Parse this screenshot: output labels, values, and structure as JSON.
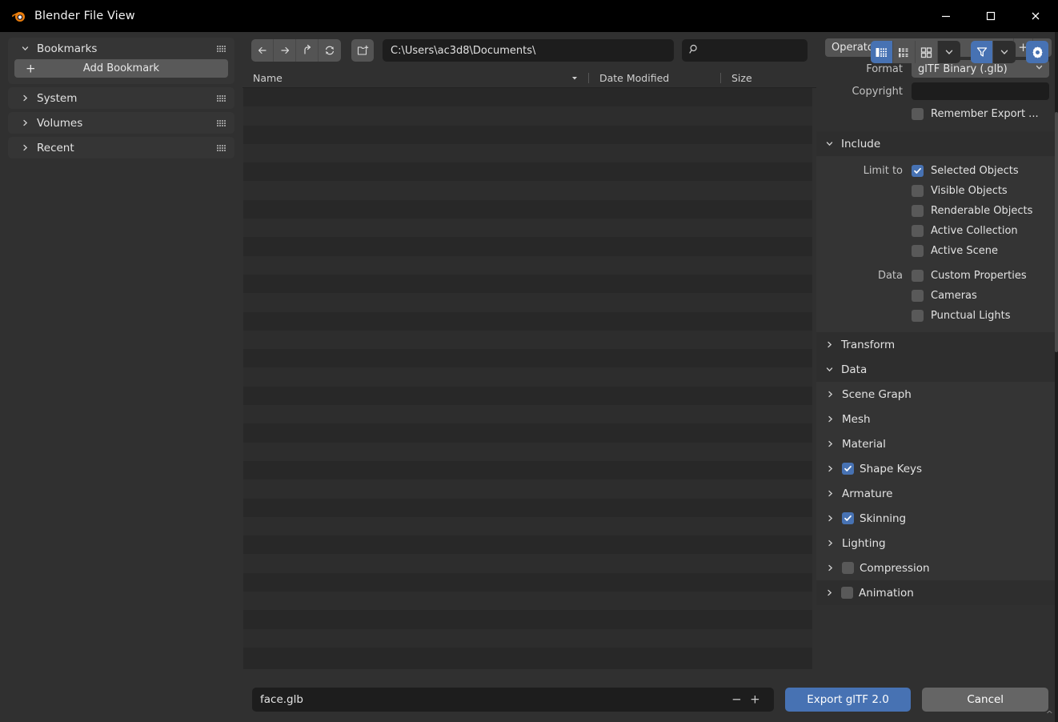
{
  "window": {
    "title": "Blender File View",
    "logo_icon": "blender-logo-icon",
    "minimize_label": "Minimize",
    "maximize_label": "Maximize",
    "close_label": "Close"
  },
  "sidebar": {
    "panels": [
      {
        "title": "Bookmarks",
        "expanded": true,
        "icon": "chevron-down-icon"
      },
      {
        "title": "System",
        "expanded": false,
        "icon": "chevron-right-icon"
      },
      {
        "title": "Volumes",
        "expanded": false,
        "icon": "chevron-right-icon"
      },
      {
        "title": "Recent",
        "expanded": false,
        "icon": "chevron-right-icon"
      }
    ],
    "add_bookmark_label": "Add Bookmark",
    "add_bookmark_icon": "plus-icon"
  },
  "toolbar": {
    "nav_icons": [
      "arrow-left-icon",
      "arrow-right-icon",
      "arrow-up-icon",
      "refresh-icon"
    ],
    "new_folder_icon": "new-folder-icon",
    "path_value": "C:\\Users\\ac3d8\\Documents\\",
    "search_placeholder": "",
    "search_icon": "search-icon",
    "view_modes": [
      {
        "name": "vertical-list-view",
        "active": true
      },
      {
        "name": "horizontal-list-view",
        "active": false
      },
      {
        "name": "thumbnail-view",
        "active": false
      }
    ],
    "display_chevron_icon": "chevron-down-icon",
    "filter_icon": "filter-icon",
    "filter_active": true,
    "filter_chevron_icon": "chevron-down-icon",
    "settings_icon": "gear-icon",
    "settings_active": true
  },
  "filelist": {
    "columns": [
      {
        "label": "Name",
        "sort_icon": "sort-descending-icon"
      },
      {
        "label": "Date Modified"
      },
      {
        "label": "Size"
      }
    ],
    "rows": []
  },
  "bottom": {
    "filename": "face.glb",
    "minus_icon": "minus-icon",
    "plus_icon": "plus-icon",
    "export_label": "Export glTF 2.0",
    "cancel_label": "Cancel"
  },
  "properties": {
    "preset": {
      "value": "Operator Presets",
      "chevron_icon": "chevron-down-icon",
      "add_icon": "plus-icon",
      "remove_icon": "minus-icon"
    },
    "format": {
      "label": "Format",
      "value": "glTF Binary (.glb)",
      "chevron_icon": "chevron-down-icon"
    },
    "copyright": {
      "label": "Copyright",
      "value": ""
    },
    "remember_export": {
      "label": "Remember Export ...",
      "checked": false
    },
    "include": {
      "title": "Include",
      "expanded": true,
      "chevron_icon": "chevron-down-icon",
      "limit_to_label": "Limit to",
      "limit_to": [
        {
          "label": "Selected Objects",
          "checked": true
        },
        {
          "label": "Visible Objects",
          "checked": false
        },
        {
          "label": "Renderable Objects",
          "checked": false
        },
        {
          "label": "Active Collection",
          "checked": false
        },
        {
          "label": "Active Scene",
          "checked": false
        }
      ],
      "data_label": "Data",
      "data": [
        {
          "label": "Custom Properties",
          "checked": false
        },
        {
          "label": "Cameras",
          "checked": false
        },
        {
          "label": "Punctual Lights",
          "checked": false
        }
      ]
    },
    "sections": [
      {
        "label": "Transform",
        "expanded": false,
        "checkbox": null,
        "chevron_icon": "chevron-right-icon"
      },
      {
        "label": "Data",
        "expanded": true,
        "checkbox": null,
        "chevron_icon": "chevron-down-icon"
      },
      {
        "label": "Scene Graph",
        "expanded": false,
        "checkbox": null,
        "chevron_icon": "chevron-right-icon"
      },
      {
        "label": "Mesh",
        "expanded": false,
        "checkbox": null,
        "chevron_icon": "chevron-right-icon"
      },
      {
        "label": "Material",
        "expanded": false,
        "checkbox": null,
        "chevron_icon": "chevron-right-icon"
      },
      {
        "label": "Shape Keys",
        "expanded": false,
        "checkbox": true,
        "chevron_icon": "chevron-right-icon"
      },
      {
        "label": "Armature",
        "expanded": false,
        "checkbox": null,
        "chevron_icon": "chevron-right-icon"
      },
      {
        "label": "Skinning",
        "expanded": false,
        "checkbox": true,
        "chevron_icon": "chevron-right-icon"
      },
      {
        "label": "Lighting",
        "expanded": false,
        "checkbox": null,
        "chevron_icon": "chevron-right-icon"
      },
      {
        "label": "Compression",
        "expanded": false,
        "checkbox": false,
        "chevron_icon": "chevron-right-icon"
      },
      {
        "label": "Animation",
        "expanded": false,
        "checkbox": false,
        "chevron_icon": "chevron-right-icon"
      }
    ]
  },
  "colors": {
    "accent_blue": "#4772b3",
    "panel_bg": "#303030",
    "field_bg": "#1d1d1d",
    "button_bg": "#545454",
    "titlebar_bg": "#000000",
    "logo_orange": "#e87d0d"
  }
}
